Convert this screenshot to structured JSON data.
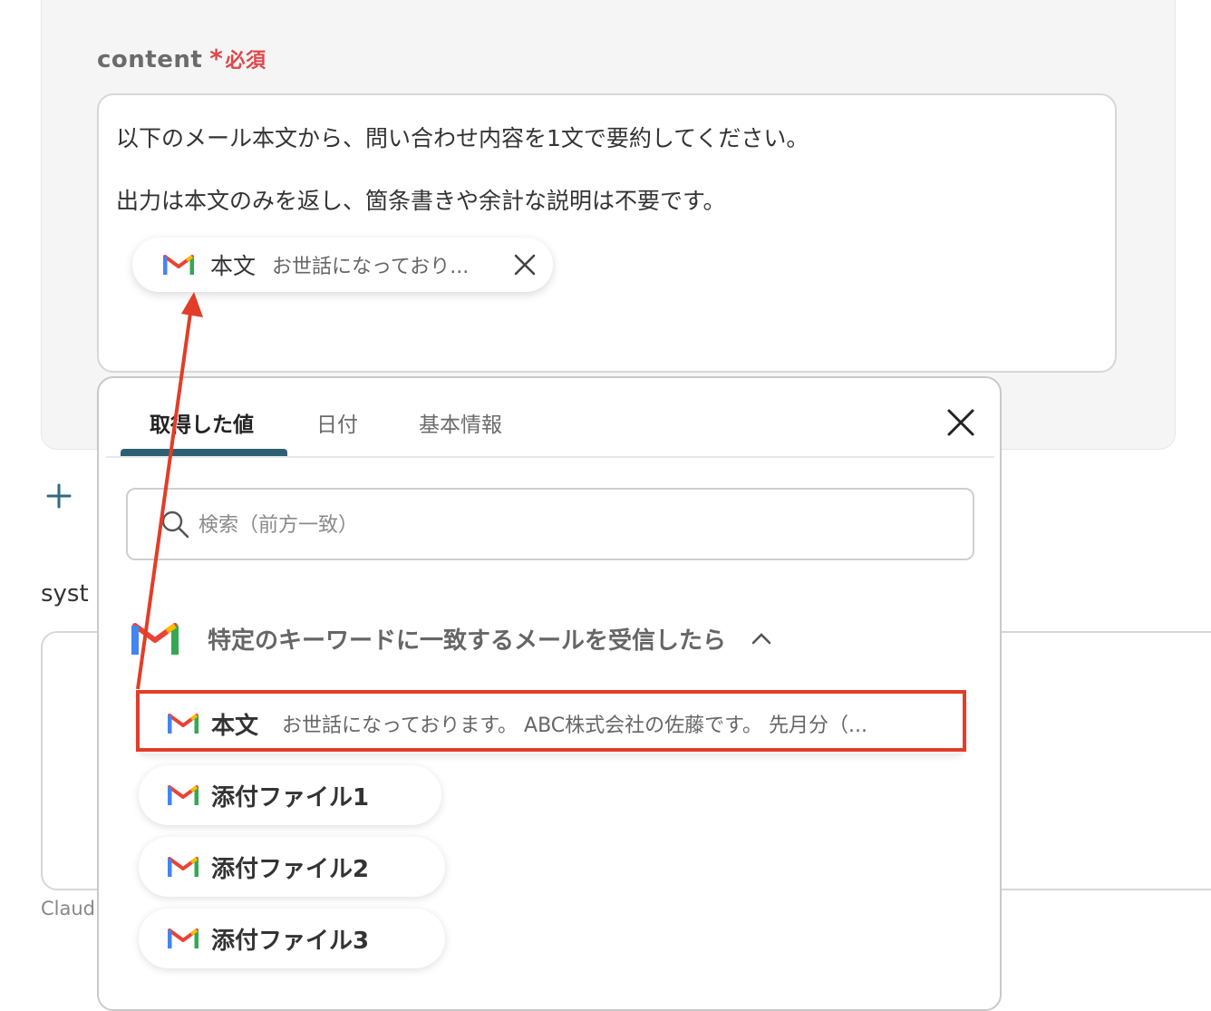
{
  "field": {
    "label": "content",
    "required_star": "*",
    "required_text": "必須"
  },
  "content": {
    "line1": "以下のメール本文から、問い合わせ内容を1文で要約してください。",
    "line2": "出力は本文のみを返し、箇条書きや余計な説明は不要です。",
    "chip": {
      "name": "本文",
      "value": "お世話になっており..."
    }
  },
  "system": {
    "label": "syst"
  },
  "footer": {
    "label": "Claud"
  },
  "popup": {
    "tabs": [
      "取得した値",
      "日付",
      "基本情報"
    ],
    "active_tab": 0,
    "search_placeholder": "検索（前方一致）",
    "group_title": "特定のキーワードに一致するメールを受信したら",
    "items": [
      {
        "name": "本文",
        "value": "お世話になっております。 ABC株式会社の佐藤です。 先月分（..."
      },
      {
        "name": "添付ファイル1",
        "value": ""
      },
      {
        "name": "添付ファイル2",
        "value": ""
      },
      {
        "name": "添付ファイル3",
        "value": ""
      }
    ]
  },
  "colors": {
    "required": "#e0484b",
    "tab_underline": "#2e5f73",
    "highlight": "#e23d28",
    "arrow": "#e23d28"
  },
  "icons": {
    "provider": "gmail-icon",
    "close": "close-icon",
    "plus": "plus-icon",
    "search": "search-icon",
    "caret": "chevron-up-icon"
  }
}
